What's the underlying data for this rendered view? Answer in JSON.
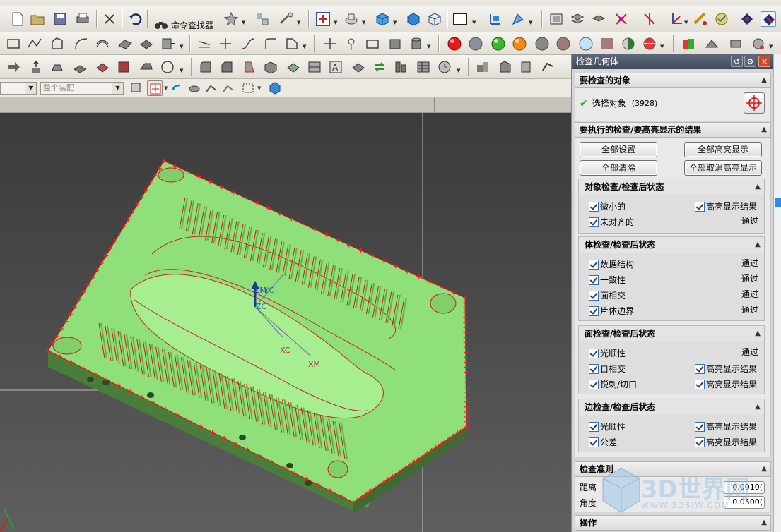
{
  "toolbar": {
    "command_finder_label": "命令查找器",
    "assembly_filter_value": "整个装配"
  },
  "dialog": {
    "title": "检查几何体",
    "objects_section": {
      "header": "要检查的对象",
      "select_label": "选择对象",
      "select_count": "(3928)"
    },
    "results_section": {
      "header": "要执行的检查/要高亮显示的结果",
      "btn_set_all": "全部设置",
      "btn_highlight_all": "全部高亮显示",
      "btn_clear_all": "全部清除",
      "btn_unhighlight_all": "全部取消高亮显示"
    },
    "object_checks": {
      "header": "对象检查/检查后状态",
      "tiny": "微小的",
      "highlight": "高亮显示结果",
      "misaligned": "未对齐的",
      "misaligned_status": "通过"
    },
    "body_checks": {
      "header": "体检查/检查后状态",
      "items": [
        {
          "label": "数据结构",
          "status": "通过"
        },
        {
          "label": "一致性",
          "status": "通过"
        },
        {
          "label": "面相交",
          "status": "通过"
        },
        {
          "label": "片体边界",
          "status": "通过"
        }
      ]
    },
    "face_checks": {
      "header": "面检查/检查后状态",
      "smoothness": "光顺性",
      "smoothness_status": "通过",
      "self_intersect": "自相交",
      "self_intersect_hl": "高亮显示结果",
      "spikes": "锐刺/切口",
      "spikes_hl": "高亮显示结果"
    },
    "edge_checks": {
      "header": "边检查/检查后状态",
      "smoothness": "光顺性",
      "smoothness_hl": "高亮显示结果",
      "tolerance": "公差",
      "tolerance_hl": "高亮显示结果"
    },
    "criteria_section": {
      "header": "检查准则",
      "distance_label": "距离",
      "distance_value": "0.0010(",
      "angle_label": "角度",
      "angle_value": "0.0500("
    },
    "operations_section": {
      "header": "操作"
    }
  },
  "viewport": {
    "axis_labels": {
      "zm": "ZM",
      "yc": "YC",
      "zc": "ZC",
      "xc": "XC",
      "xm": "XM"
    }
  },
  "watermark": {
    "text": "3D世界网",
    "url": "WWW.3DSJW.COM"
  },
  "colors": {
    "part": "#8fe07a",
    "edge_markers": "#ff1a1a",
    "dialog_title": "#4a5566",
    "check_green": "#2aa02a"
  }
}
